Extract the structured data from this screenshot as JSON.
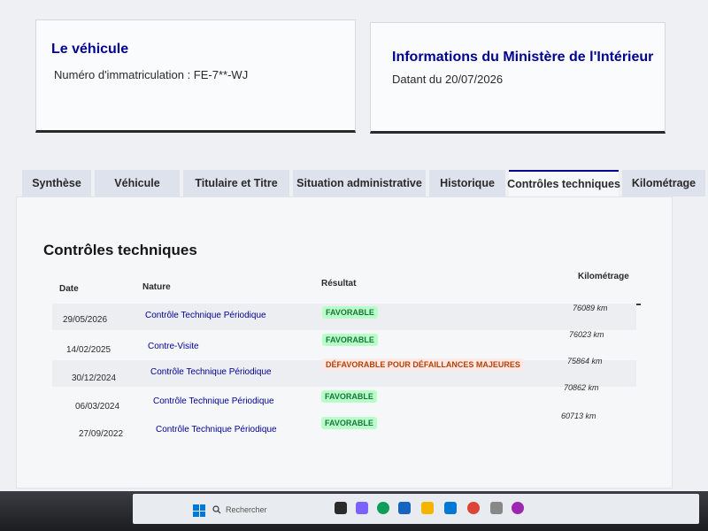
{
  "vehicle_card": {
    "title": "Le véhicule",
    "plate_text": "Numéro d'immatriculation : FE-7**-WJ"
  },
  "ministry_card": {
    "title": "Informations du Ministère de l'Intérieur",
    "date_text": "Datant du 20/07/2026"
  },
  "tabs": [
    {
      "label": "Synthèse",
      "active": false
    },
    {
      "label": "Véhicule",
      "active": false
    },
    {
      "label": "Titulaire et Titre",
      "active": false
    },
    {
      "label": "Situation administrative",
      "active": false
    },
    {
      "label": "Historique",
      "active": false
    },
    {
      "label": "Contrôles techniques",
      "active": true
    },
    {
      "label": "Kilométrage",
      "active": false
    }
  ],
  "panel": {
    "title": "Contrôles techniques",
    "headers": {
      "date": "Date",
      "nature": "Nature",
      "result": "Résultat",
      "mileage": "Kilométrage"
    },
    "rows": [
      {
        "date": "29/05/2026",
        "nature": "Contrôle Technique Périodique",
        "result": "FAVORABLE",
        "status": "ok",
        "km": "76089 km"
      },
      {
        "date": "14/02/2025",
        "nature": "Contre-Visite",
        "result": "FAVORABLE",
        "status": "ok",
        "km": "76023 km"
      },
      {
        "date": "30/12/2024",
        "nature": "Contrôle Technique Périodique",
        "result": "DÉFAVORABLE POUR DÉFAILLANCES MAJEURES",
        "status": "ko",
        "km": "75864 km"
      },
      {
        "date": "06/03/2024",
        "nature": "Contrôle Technique Périodique",
        "result": "FAVORABLE",
        "status": "ok",
        "km": "70862 km"
      },
      {
        "date": "27/09/2022",
        "nature": "Contrôle Technique Périodique",
        "result": "FAVORABLE",
        "status": "ok",
        "km": "60713 km"
      }
    ]
  },
  "taskbar": {
    "search_placeholder": "Rechercher"
  },
  "colors": {
    "primary": "#000091",
    "ok_bg": "#b8fec9",
    "ok_text": "#18753c",
    "ko_bg": "#ffe9e6",
    "ko_text": "#b34000"
  }
}
